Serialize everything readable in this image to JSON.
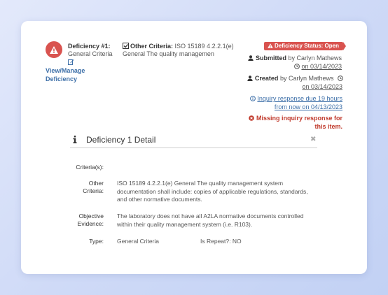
{
  "deficiency": {
    "label": "Deficiency #1:",
    "category": "General Criteria",
    "manage_link_line1": "View/Manage",
    "manage_link_line2": "Deficiency"
  },
  "criteria_summary": {
    "label": "Other Criteria:",
    "code": "ISO 15189 4.2.2.1(e)",
    "text": "General The quality managemen"
  },
  "status": {
    "badge_label": "Deficiency Status: Open",
    "submitted_label": "Submitted",
    "submitted_by": "by Carlyn Mathews",
    "submitted_on": "on 03/14/2023",
    "created_label": "Created",
    "created_by": "by Carlyn Mathews",
    "created_on": "on 03/14/2023",
    "inquiry_line1": "Inquiry response due 19 hours",
    "inquiry_line2": "from now on 04/13/2023",
    "missing_line1": "Missing inquiry response for",
    "missing_line2": "this item."
  },
  "detail": {
    "title": "Deficiency 1 Detail",
    "criteria_label": "Criteria(s):",
    "other_label_line1": "Other",
    "other_label_line2": "Criteria:",
    "other_value_line1": "ISO 15189 4.2.2.1(e) General The quality management system",
    "other_value_line2": "documentation shall include: copies of applicable regulations, standards,",
    "other_value_line3": "and other normative documents.",
    "objective_label_line1": "Objective",
    "objective_label_line2": "Evidence:",
    "objective_value_line1": "The laboratory does not have all A2LA normative documents controlled",
    "objective_value_line2": "within their quality management system (i.e. R103).",
    "type_label": "Type:",
    "type_value": "General Criteria",
    "repeat_label": "Is Repeat?: NO"
  },
  "colors": {
    "danger": "#d9534f",
    "link": "#3d6fa8",
    "background": "#cfdaf7"
  },
  "icons": [
    "warning-icon",
    "edit-icon",
    "checkbox-icon",
    "user-icon",
    "clock-icon",
    "info-circle-icon",
    "times-circle-icon",
    "info-icon",
    "close-icon"
  ]
}
